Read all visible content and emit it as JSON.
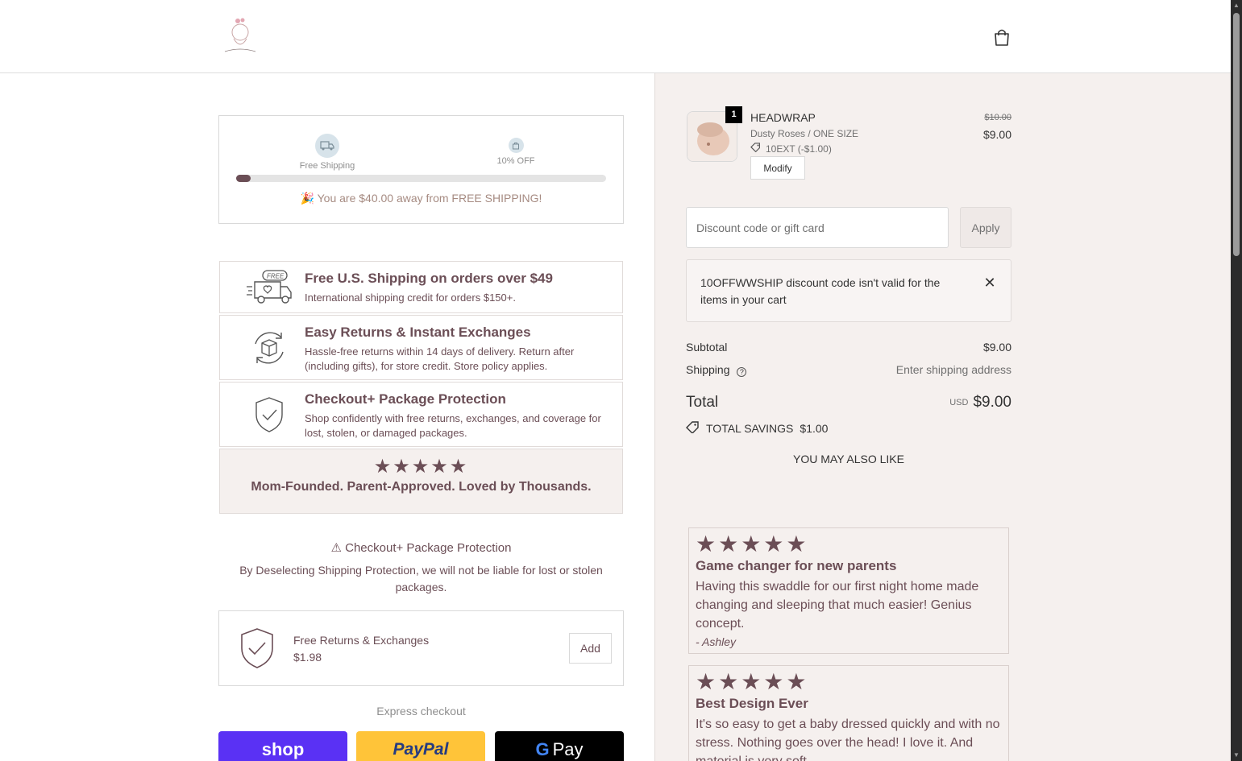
{
  "header": {
    "logo_text": "Mama Tori",
    "cart_icon": "shopping-bag-icon"
  },
  "shipping_progress": {
    "milestone_1": "Free Shipping",
    "milestone_2": "10% OFF",
    "progress_fraction": 0.04,
    "message": "You are $40.00 away from FREE SHIPPING!"
  },
  "trust": [
    {
      "title": "Free U.S. Shipping on orders over $49",
      "desc": "International shipping credit for orders $150+."
    },
    {
      "title": "Easy Returns & Instant Exchanges",
      "desc": "Hassle-free returns within 14 days of delivery. Return after (including gifts), for store credit. Store policy applies."
    },
    {
      "title": "Checkout+ Package Protection",
      "desc": "Shop confidently with free returns, exchanges, and coverage for lost, stolen, or damaged packages."
    }
  ],
  "banner": {
    "stars": "★★★★★",
    "text": "Mom-Founded. Parent-Approved. Loved by Thousands."
  },
  "package_protection": {
    "title": "⚠ Checkout+ Package Protection",
    "desc": "By Deselecting Shipping Protection, we will not be liable for lost or stolen packages.",
    "item_label": "Free Returns & Exchanges",
    "item_price": "$1.98",
    "add_label": "Add"
  },
  "express": {
    "label": "Express checkout",
    "shop_label": "shop",
    "paypal_label": "PayPal",
    "gpay_label": "Pay"
  },
  "order": {
    "item": {
      "quantity": "1",
      "name": "HEADWRAP",
      "variant": "Dusty Roses / ONE SIZE",
      "discount": "10EXT (-$1.00)",
      "modify_label": "Modify",
      "old_price": "$10.00",
      "price": "$9.00"
    },
    "discount_placeholder": "Discount code or gift card",
    "apply_label": "Apply",
    "error": "10OFFWWSHIP discount code isn't valid for the items in your cart",
    "subtotal_label": "Subtotal",
    "subtotal_value": "$9.00",
    "shipping_label": "Shipping",
    "shipping_value": "Enter shipping address",
    "total_label": "Total",
    "total_currency": "USD",
    "total_value": "$9.00",
    "savings_label": "TOTAL SAVINGS",
    "savings_value": "$1.00",
    "also_like": "YOU MAY ALSO LIKE"
  },
  "reviews": [
    {
      "stars": "★★★★★",
      "title": "Game changer for new parents",
      "body": "Having this swaddle for our first night home made changing and sleeping that much easier! Genius concept.",
      "author": "-  Ashley"
    },
    {
      "stars": "★★★★★",
      "title": "Best Design Ever",
      "body": "It's so easy to get a baby dressed quickly and with no stress. Nothing goes over the head! I love it. And material is very soft.",
      "author": ""
    }
  ],
  "colors": {
    "brand": "#6b4e56",
    "panel_bg": "#f5f0ee",
    "shop_pay": "#5a31f4",
    "paypal": "#ffc439"
  }
}
